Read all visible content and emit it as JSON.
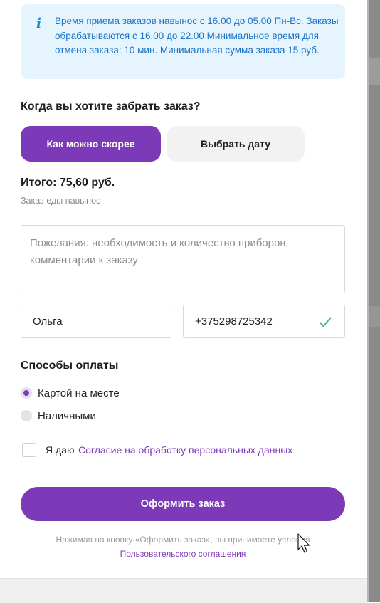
{
  "info": {
    "icon": "info-icon",
    "text": "Время приема заказов навынос с 16.00 до 05.00 Пн-Вс. Заказы обрабатываются с 16.00 до 22.00 Минимальное время для отмена заказа: 10 мин. Минимальная сумма заказа 15 руб."
  },
  "pickup": {
    "heading": "Когда вы хотите забрать заказ?",
    "options": [
      "Как можно скорее",
      "Выбрать дату"
    ],
    "selected": "Как можно скорее"
  },
  "total": {
    "label": "Итого: 75,60 руб.",
    "subtitle": "Заказ еды навынос"
  },
  "form": {
    "wishes_placeholder": "Пожелания: необходимость и количество приборов, комментарии к заказу",
    "name_value": "Ольга",
    "phone_value": "+375298725342",
    "phone_valid_icon": "check-icon"
  },
  "payment": {
    "heading": "Способы оплаты",
    "options": [
      "Картой на месте",
      "Наличными"
    ],
    "selected": "Картой на месте"
  },
  "consent": {
    "prefix": "Я даю",
    "link": "Согласие на обработку персональных данных",
    "checked": false
  },
  "submit": {
    "label": "Оформить заказ"
  },
  "footer": {
    "disclaimer": "Нажимая на кнопку «Оформить заказ», вы принимаете условия",
    "terms_link": "Пользовательского соглашения"
  },
  "colors": {
    "accent": "#7c3ab8",
    "info_bg": "#e6f4fd",
    "info_text": "#1a73c8",
    "success": "#3db48a"
  }
}
